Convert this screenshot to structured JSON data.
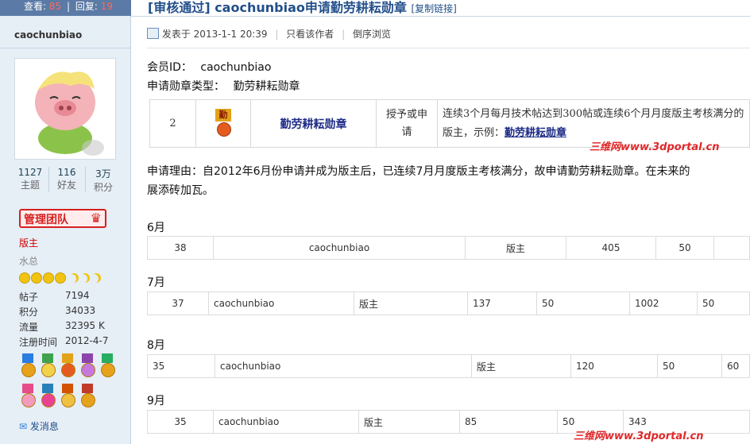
{
  "top_bar": {
    "views_label": "查看:",
    "views": "85",
    "sep": "|",
    "replies_label": "回复:",
    "replies": "19"
  },
  "post": {
    "title": "[审核通过] caochunbiao申请勤劳耕耘勋章",
    "copy_link": "[复制链接]",
    "posted_prefix": "发表于",
    "posted_time": "2013-1-1 20:39",
    "only_author": "只看该作者",
    "reverse_view": "倒序浏览"
  },
  "author": {
    "username": "caochunbiao",
    "stats": [
      {
        "value": "1127",
        "label": "主题"
      },
      {
        "value": "116",
        "label": "好友"
      },
      {
        "value": "3万",
        "label": "积分"
      }
    ],
    "group_badge": "管理团队",
    "rank_title": "版主",
    "sub_title": "水总",
    "info": [
      {
        "label": "帖子",
        "value": "7194"
      },
      {
        "label": "积分",
        "value": "34033"
      },
      {
        "label": "流量",
        "value": "32395 K"
      },
      {
        "label": "注册时间",
        "value": "2012-4-7"
      }
    ],
    "send_message": "发消息"
  },
  "body": {
    "member_id_label": "会员ID：",
    "member_id": "caochunbiao",
    "medal_type_label": "申请勋章类型：",
    "medal_type": "勤劳耕耘勋章",
    "medal_table": {
      "num": "2",
      "medal_glyph": "勤",
      "name": "勤劳耕耘勋章",
      "method": "授予或申请",
      "desc": "连续3个月每月技术帖达到300帖或连续6个月月度版主考核满分的版主，示例：",
      "example": "勤劳耕耘勋章"
    },
    "reason_line1": "申请理由：自2012年6月份申请并成为版主后，已连续7月月度版主考核满分，故申请勤劳耕耘勋章。在未来的",
    "reason_line2": "展添砖加瓦。",
    "watermark": "三维网www.3dportal.cn"
  },
  "months": [
    {
      "label": "6月",
      "cells": [
        "38",
        "caochunbiao",
        "版主",
        "405",
        "50",
        ""
      ]
    },
    {
      "label": "7月",
      "cells": [
        "37",
        "caochunbiao",
        "版主",
        "137",
        "50",
        "1002",
        "50"
      ]
    },
    {
      "label": "8月",
      "cells": [
        "35",
        "caochunbiao",
        "版主",
        "120",
        "50",
        "60"
      ]
    },
    {
      "label": "9月",
      "cells": [
        "35",
        "caochunbiao",
        "版主",
        "85",
        "50",
        "343"
      ]
    }
  ]
}
